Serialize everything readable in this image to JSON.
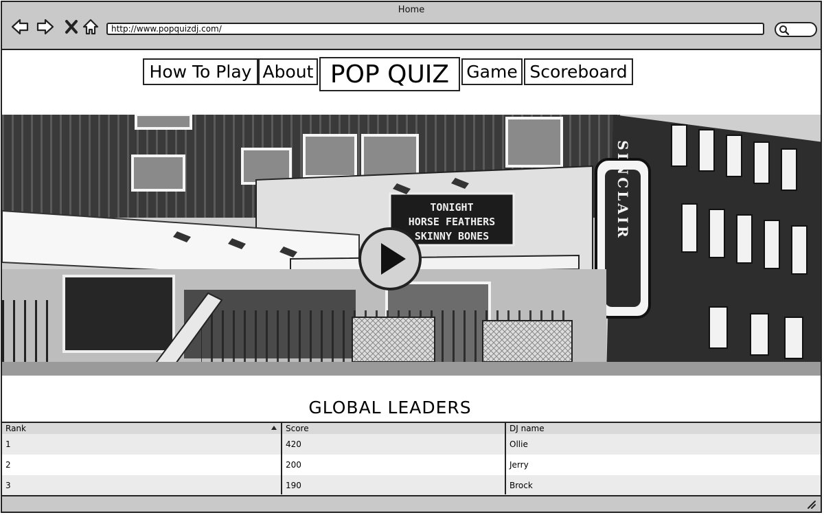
{
  "window": {
    "title": "Home"
  },
  "browser": {
    "url": "http://www.popquizdj.com/",
    "icons": [
      "back-arrow-icon",
      "forward-arrow-icon",
      "close-icon",
      "home-icon",
      "search-icon"
    ]
  },
  "nav": {
    "how_to_play": "How To Play",
    "about": "About",
    "brand": "POP QUIZ",
    "game": "Game",
    "scoreboard": "Scoreboard"
  },
  "hero": {
    "play_icon": "play-icon",
    "sign_lines": [
      "TONIGHT",
      "HORSE FEATHERS",
      "SKINNY BONES"
    ],
    "vertical_sign": "SINCLAIR"
  },
  "leaders": {
    "title": "GLOBAL LEADERS",
    "columns": [
      "Rank",
      "Score",
      "DJ name"
    ],
    "sort_column": "Rank",
    "rows": [
      {
        "rank": "1",
        "score": "420",
        "dj": "Ollie"
      },
      {
        "rank": "2",
        "score": "200",
        "dj": "Jerry"
      },
      {
        "rank": "3",
        "score": "190",
        "dj": "Brock"
      }
    ]
  },
  "colors": {
    "chrome": "#c9c9c9",
    "border": "#222222",
    "row_alt": "#ebebeb",
    "header_bg": "#d9d9d9"
  }
}
